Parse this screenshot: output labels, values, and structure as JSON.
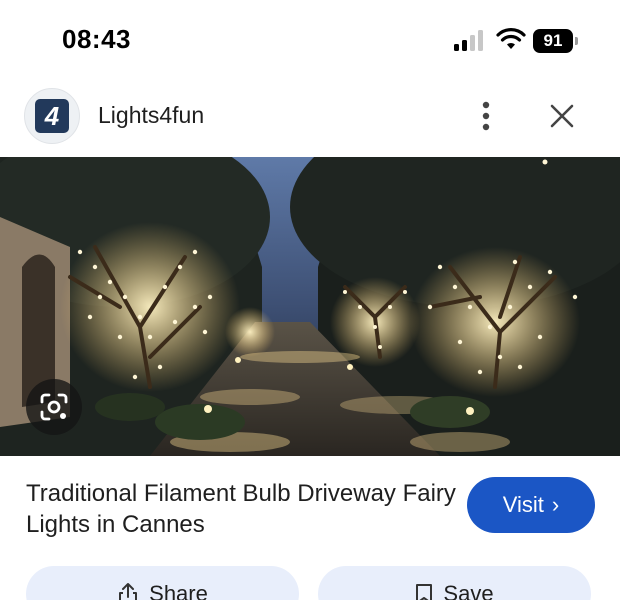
{
  "status_bar": {
    "time": "08:43",
    "battery": "91"
  },
  "header": {
    "logo_text": "4",
    "site_name": "Lights4fun"
  },
  "hero": {
    "alt_description_icon": "google-lens-icon"
  },
  "result": {
    "title": "Traditional Filament Bulb Driveway Fairy Lights in Cannes",
    "visit_label": "Visit",
    "visit_chevron": "›"
  },
  "actions": {
    "share_label": "Share",
    "save_label": "Save"
  },
  "colors": {
    "visit_bg": "#1b56c5",
    "action_bg": "#e8eefb",
    "logo_bg": "#22395b"
  }
}
